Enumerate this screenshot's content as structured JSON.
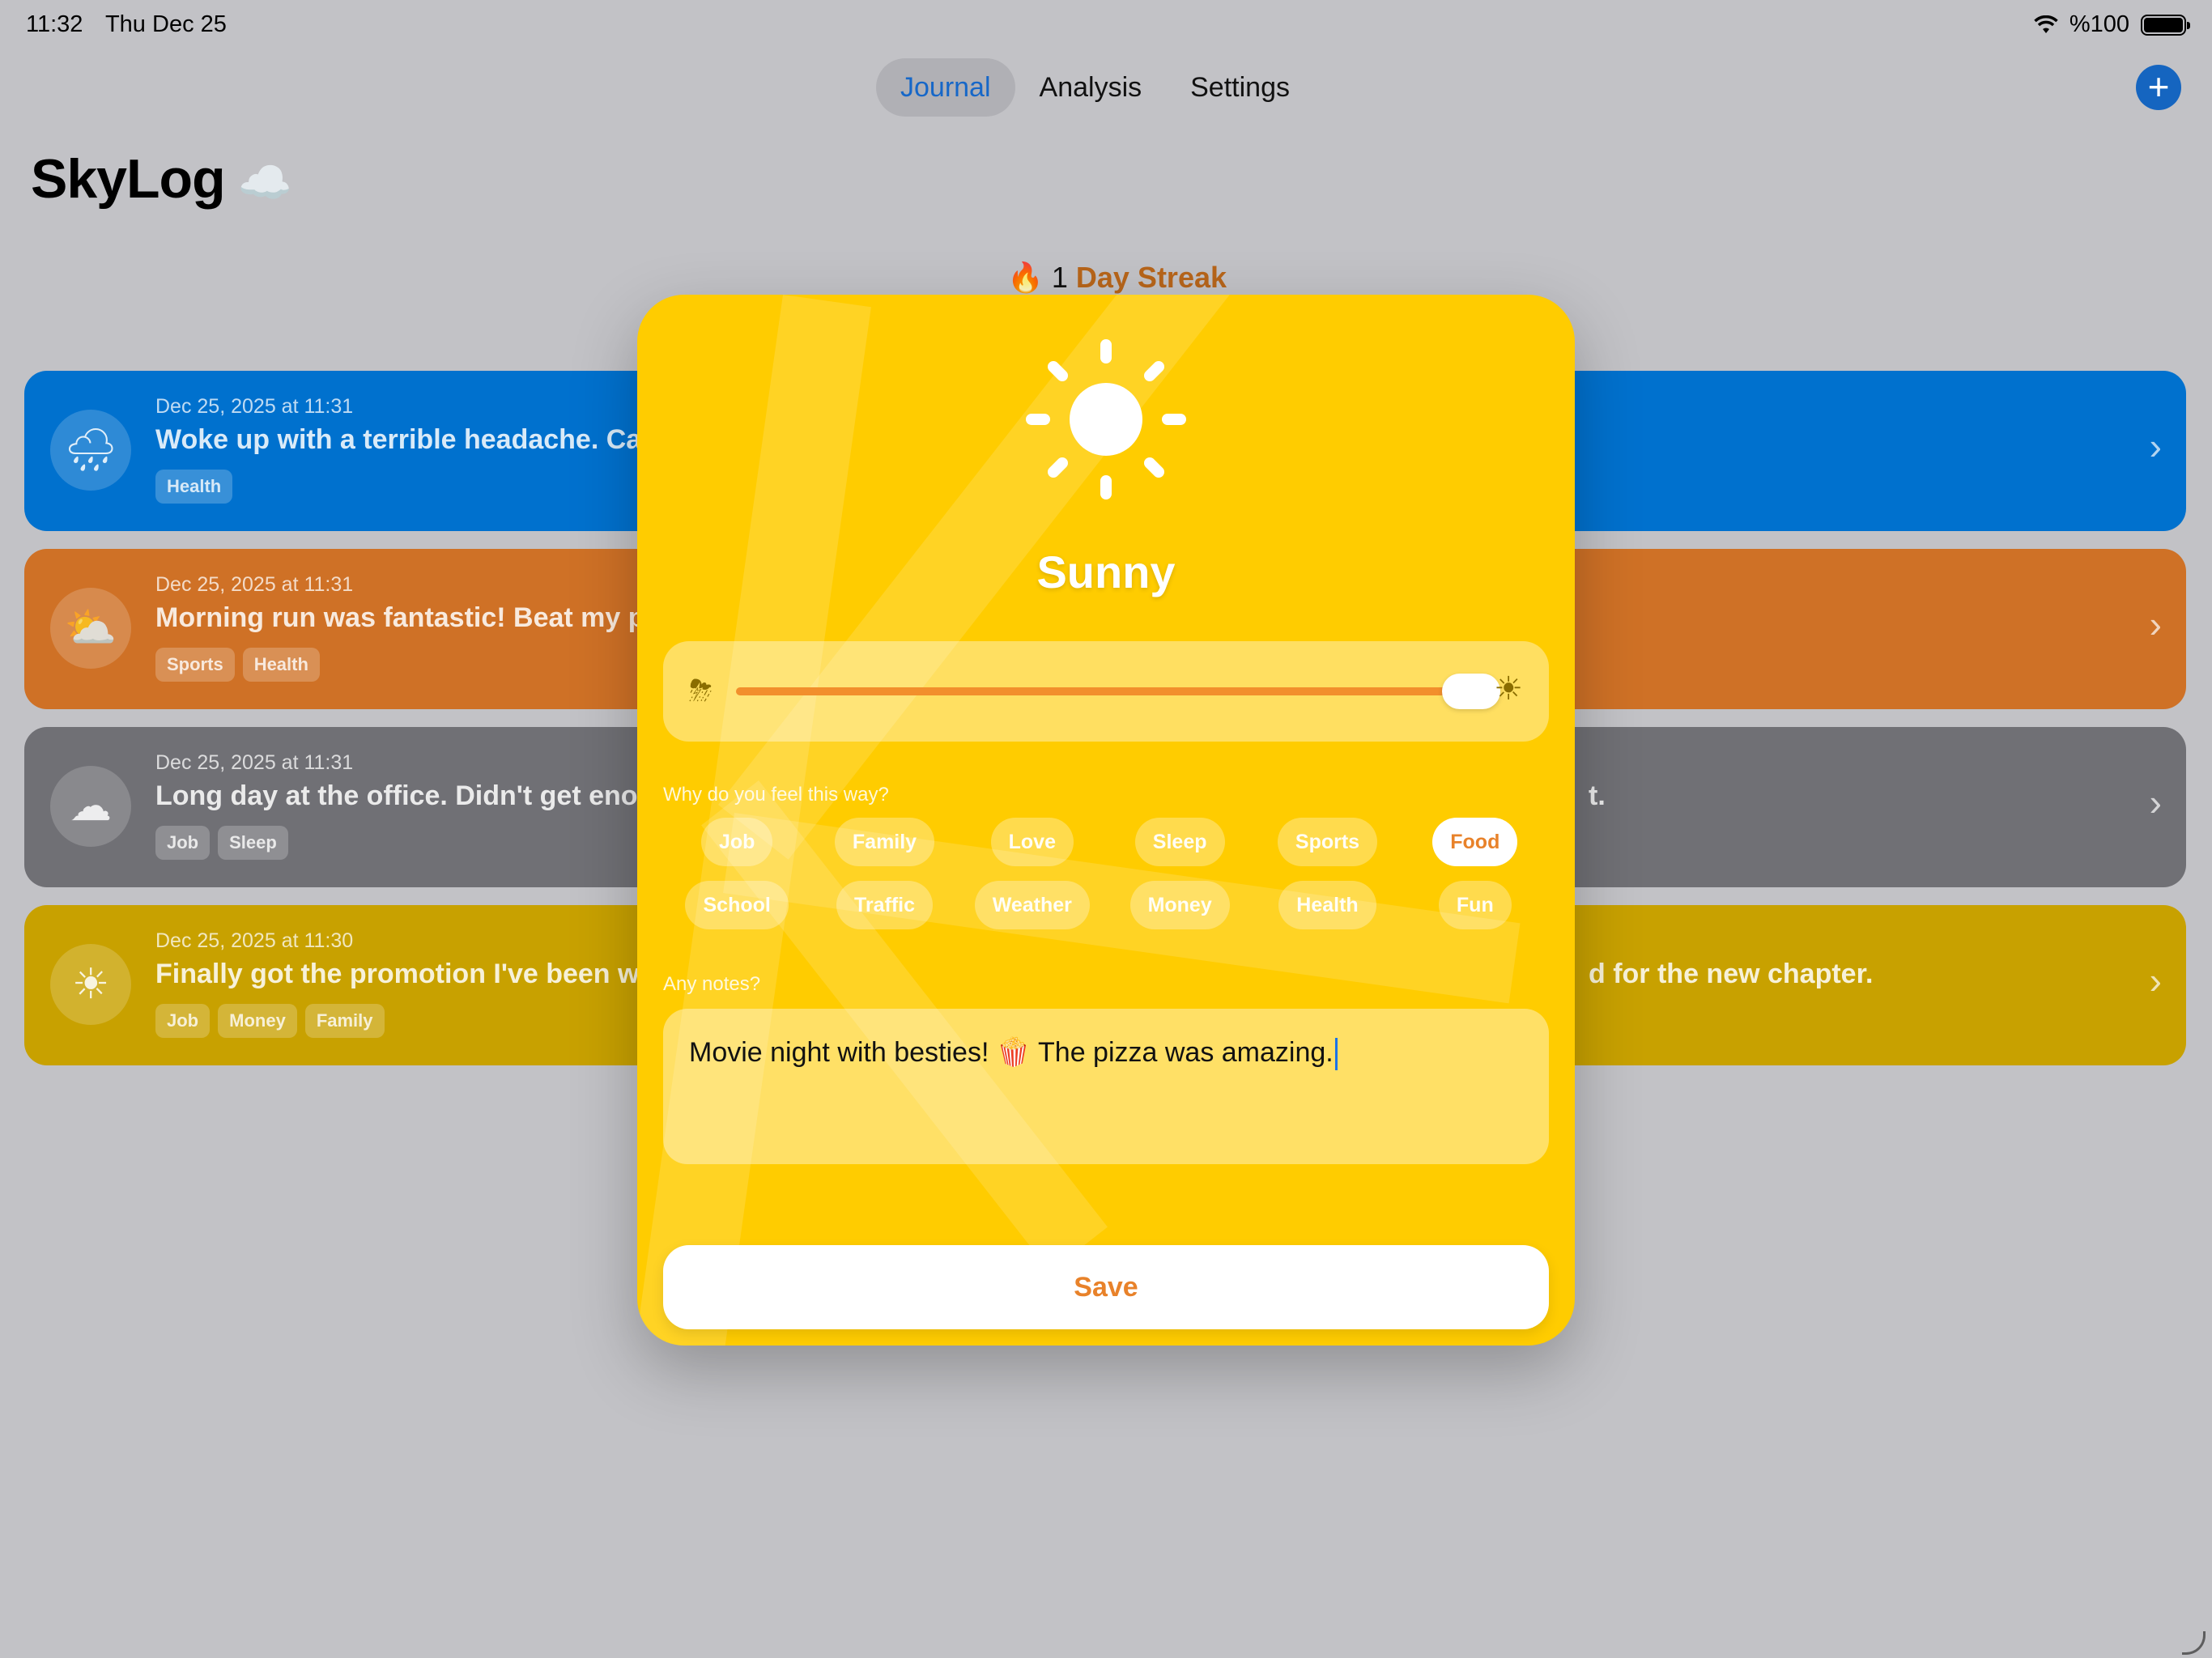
{
  "status_bar": {
    "time": "11:32",
    "date": "Thu Dec 25",
    "battery": "%100"
  },
  "nav": {
    "tabs": [
      {
        "label": "Journal"
      },
      {
        "label": "Analysis"
      },
      {
        "label": "Settings"
      }
    ],
    "add_label": "+"
  },
  "app": {
    "title": "SkyLog",
    "title_icon": "☁️"
  },
  "streak": {
    "icon": "🔥",
    "count": "1",
    "label": "Day Streak"
  },
  "entries": [
    {
      "date": "Dec 25, 2025 at 11:31",
      "text": "Woke up with a terrible headache. Ca",
      "text_tail": "",
      "icon": "rain-cloud-icon",
      "glyph": "🌧",
      "tags": [
        "Health"
      ],
      "color": "#0071ce"
    },
    {
      "date": "Dec 25, 2025 at 11:31",
      "text": "Morning run was fantastic! Beat my p",
      "text_tail": "",
      "icon": "partly-sunny-icon",
      "glyph": "⛅",
      "tags": [
        "Sports",
        "Health"
      ],
      "color": "#cf7126"
    },
    {
      "date": "Dec 25, 2025 at 11:31",
      "text": "Long day at the office. Didn't get enou",
      "text_tail": "t.",
      "icon": "cloud-icon",
      "glyph": "☁",
      "tags": [
        "Job",
        "Sleep"
      ],
      "color": "#707075"
    },
    {
      "date": "Dec 25, 2025 at 11:30",
      "text": "Finally got the promotion I've been wo",
      "text_tail": "d for the new chapter.",
      "icon": "sun-icon",
      "glyph": "☀",
      "tags": [
        "Job",
        "Money",
        "Family"
      ],
      "color": "#c8a100"
    }
  ],
  "modal": {
    "mood": "Sunny",
    "slider": {
      "value": 1.0,
      "left_icon": "storm-cloud-icon",
      "right_icon": "sun-icon"
    },
    "why_label": "Why do you feel this way?",
    "tags": [
      {
        "label": "Job",
        "selected": false
      },
      {
        "label": "Family",
        "selected": false
      },
      {
        "label": "Love",
        "selected": false
      },
      {
        "label": "Sleep",
        "selected": false
      },
      {
        "label": "Sports",
        "selected": false
      },
      {
        "label": "Food",
        "selected": true
      },
      {
        "label": "School",
        "selected": false
      },
      {
        "label": "Traffic",
        "selected": false
      },
      {
        "label": "Weather",
        "selected": false
      },
      {
        "label": "Money",
        "selected": false
      },
      {
        "label": "Health",
        "selected": false
      },
      {
        "label": "Fun",
        "selected": false
      }
    ],
    "notes_label": "Any notes?",
    "notes_value": "Movie night with besties! 🍿 The pizza was amazing.",
    "save_label": "Save",
    "accent": "#ffcc00",
    "save_color": "#e8822a"
  }
}
